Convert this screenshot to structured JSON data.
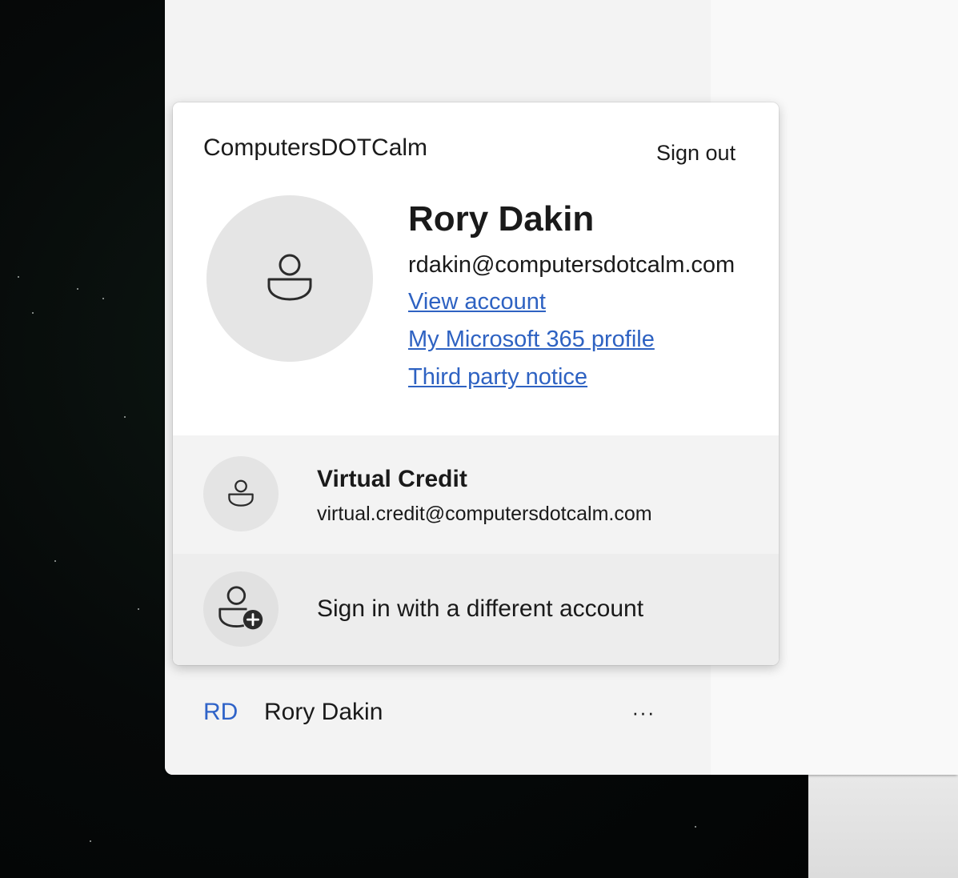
{
  "flyout": {
    "org_name": "ComputersDOTCalm",
    "sign_out_label": "Sign out",
    "user": {
      "name": "Rory Dakin",
      "email": "rdakin@computersdotcalm.com",
      "avatar_icon": "person-icon"
    },
    "links": {
      "view_account": "View account",
      "m365_profile": "My Microsoft 365 profile",
      "third_party_notice": "Third party notice"
    },
    "other_account": {
      "name": "Virtual Credit",
      "email": "virtual.credit@computersdotcalm.com",
      "avatar_icon": "person-icon"
    },
    "add_account": {
      "label": "Sign in with a different account",
      "icon": "person-add-icon"
    }
  },
  "footer": {
    "initials": "RD",
    "name": "Rory Dakin",
    "more_label": "···"
  },
  "colors": {
    "link": "#2e62c2",
    "initials": "#2f63c8"
  }
}
